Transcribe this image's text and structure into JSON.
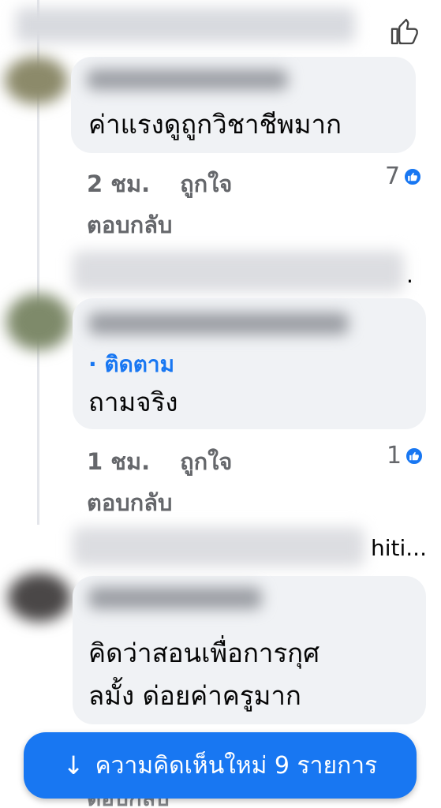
{
  "comments": [
    {
      "text": "ค่าแรงดูถูกวิชาชีพมาก",
      "time": "2 ชม.",
      "like_label": "ถูกใจ",
      "reply_label": "ตอบกลับ",
      "reactions": "7"
    },
    {
      "follow_label": "· ติดตาม",
      "text": "ถามจริง",
      "time": "1 ชม.",
      "like_label": "ถูกใจ",
      "reply_label": "ตอบกลับ",
      "reactions": "1",
      "trailing_dot": "."
    },
    {
      "name_fragment": "hiti...",
      "text_line1": "คิดว่าสอนเพื่อการกุศ",
      "text_line2": "ลมั้ง ด่อยค่าครูมาก"
    }
  ],
  "new_comments_button": {
    "arrow": "↓",
    "label": "ความคิดเห็นใหม่ 9 รายการ"
  },
  "behind_button_text": "ตอบกลับ",
  "colors": {
    "accent": "#1877f2",
    "bubble": "#f0f2f5",
    "meta": "#65676b"
  },
  "icons": [
    "thumbs-up-icon",
    "like-reaction-icon",
    "arrow-down-icon"
  ]
}
